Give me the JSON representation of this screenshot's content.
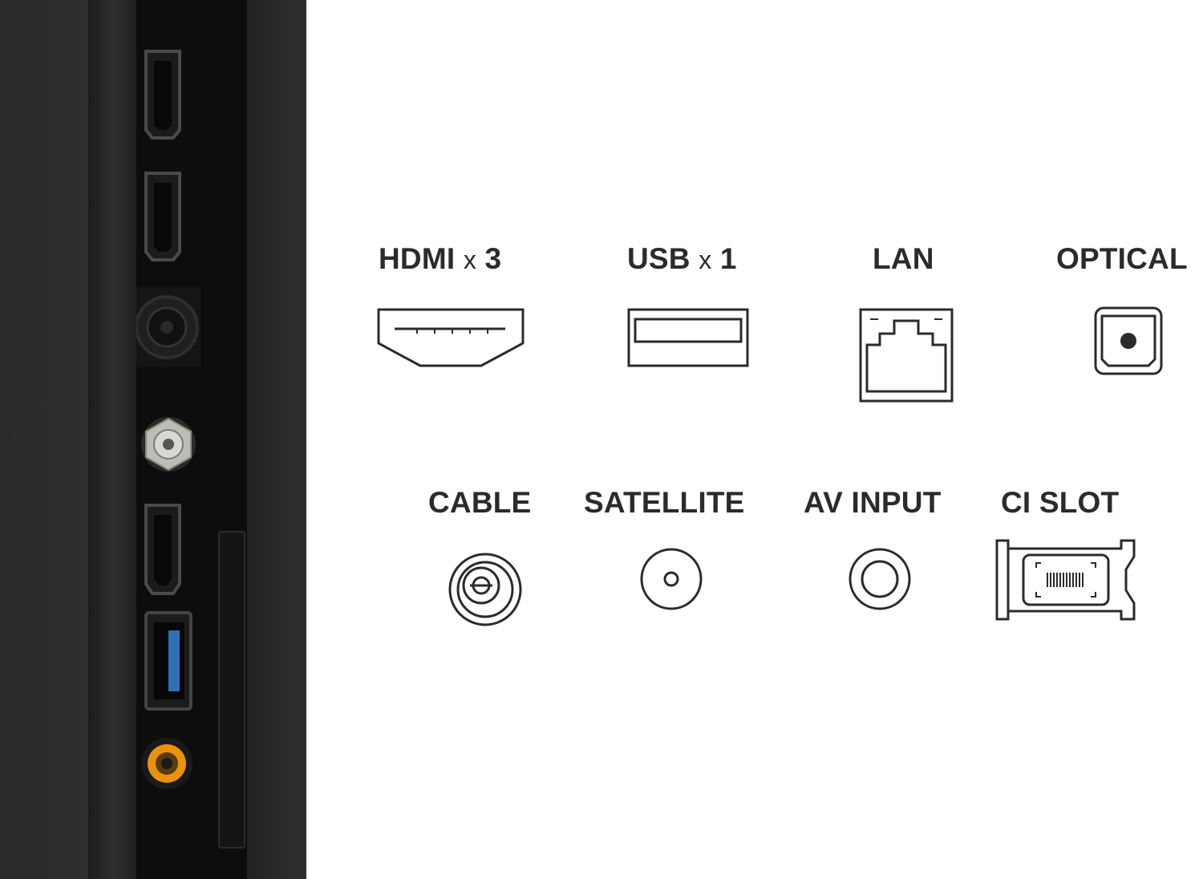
{
  "labels": {
    "hdmi": {
      "name": "HDMI",
      "mult": "x",
      "count": "3"
    },
    "usb": {
      "name": "USB",
      "mult": "x",
      "count": "1"
    },
    "lan": "LAN",
    "optical": "OPTICAL",
    "cable": "CABLE",
    "satellite": "SATELLITE",
    "av_input": "AV INPUT",
    "ci_slot": "CI SLOT"
  },
  "colors": {
    "background": "#ffffff",
    "text": "#2b2b2b",
    "tv_body": "#2f2f2f",
    "port_strip": "#0d0d0d",
    "av_port_accent": "#e8920f",
    "usb3_accent": "#2f6fb8"
  },
  "icons": [
    "hdmi-port-icon",
    "usb-port-icon",
    "lan-port-icon",
    "optical-port-icon",
    "cable-port-icon",
    "satellite-port-icon",
    "av-input-port-icon",
    "ci-slot-icon"
  ]
}
